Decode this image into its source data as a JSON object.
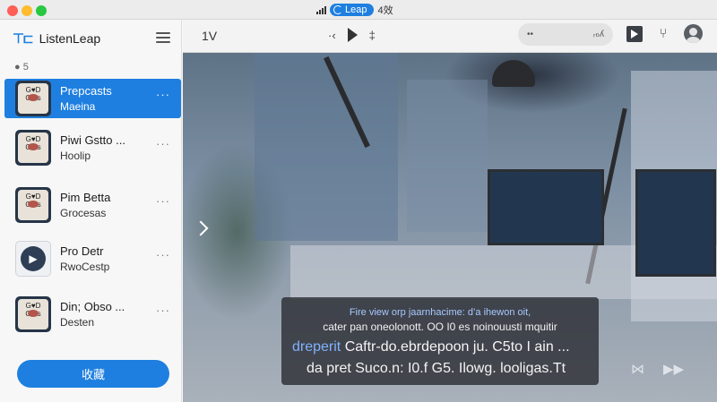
{
  "titlebar": {
    "app_badge": "Leap",
    "trailing_text": "4效"
  },
  "sidebar": {
    "app_name": "ListenLeap",
    "section_label": "5",
    "items": [
      {
        "thumb": "G♥D\nOf♥s",
        "title": "Prepcasts",
        "subtitle": "Maeina",
        "more": "···"
      },
      {
        "thumb": "G♥D\nOf♥s",
        "title": "Piwi Gstto ...",
        "subtitle": "Hoolip",
        "more": "···"
      },
      {
        "thumb": "G♥D\nOf♥s",
        "title": "Pim Betta",
        "subtitle": "Grocesas",
        "more": "···"
      },
      {
        "thumb": "play",
        "title": "Pro Detr",
        "subtitle": "RwoCestp",
        "more": "···"
      },
      {
        "thumb": "G♥D\nOf♥s",
        "title": "Din; Obso ...",
        "subtitle": "Desten",
        "more": "···"
      }
    ],
    "collect_button": "收藏"
  },
  "toolbar": {
    "left_label": "1V",
    "prev_label": "·‹",
    "next_label": "‡",
    "search_left": "••",
    "search_right": "ᵣℴʎ"
  },
  "video": {
    "subtitles": {
      "line1": "Fire view orp jaarnhacime: d’a ihewon oit,",
      "line2": "cater pan oneolonott. OO I0 es noinouusti mquitir",
      "line3_highlight": "dreperit",
      "line3_rest": " Caftr-do.ebrdepoon ju. C5to I ain ...",
      "line4": "da pret Suco.n: I0.f G5. Ilowg. looligas.Tt"
    }
  },
  "colors": {
    "accent": "#1e7fe0",
    "sidebar_bg": "#f7f7f7",
    "subtitle_highlight": "#7fb3ff"
  }
}
